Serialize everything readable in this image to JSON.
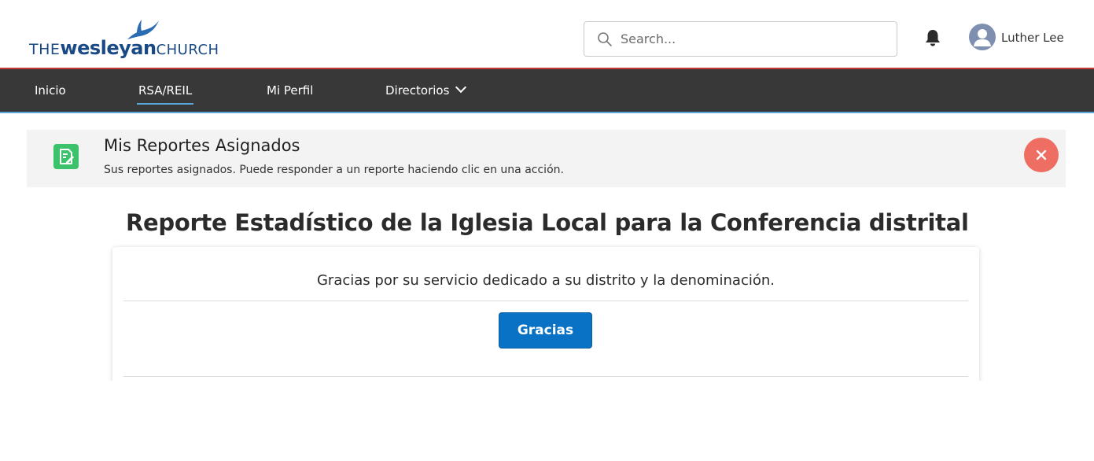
{
  "header": {
    "logo": {
      "the": "THE",
      "wesleyan": "wesleyan",
      "church": "CHURCH",
      "brand_color": "#1a4a86",
      "flame_color": "#2a6cb4"
    },
    "search": {
      "placeholder": "Search...",
      "value": "",
      "icon": "search-icon"
    },
    "notifications_icon": "bell-icon",
    "user": {
      "name": "Luther Lee",
      "avatar_icon": "user-avatar-icon",
      "avatar_color": "#7e8fb0"
    }
  },
  "nav": {
    "items": [
      {
        "label": "Inicio",
        "active": false
      },
      {
        "label": "RSA/REIL",
        "active": true
      },
      {
        "label": "Mi Perfil",
        "active": false
      },
      {
        "label": "Directorios",
        "active": false,
        "dropdown": true
      }
    ],
    "background": "#383838",
    "accent": "#5aa6d8"
  },
  "banner": {
    "icon": "report-edit-icon",
    "icon_color": "#3bc26b",
    "title": "Mis Reportes Asignados",
    "subtitle": "Sus reportes asignados. Puede responder a un reporte haciendo clic en una acción.",
    "close_icon": "close-icon",
    "close_color": "#ef6e64"
  },
  "main": {
    "title": "Reporte Estadístico de la Iglesia Local para la Conferencia distrital",
    "message": "Gracias por su servicio dedicado a su distrito y la denominación.",
    "button_label": "Gracias",
    "button_color": "#0a72c4"
  }
}
